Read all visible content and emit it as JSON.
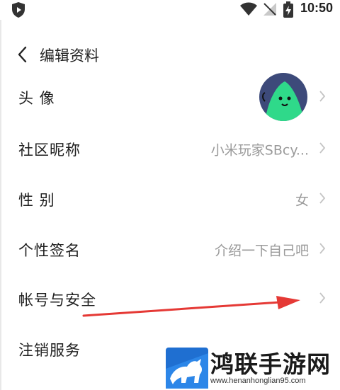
{
  "status_bar": {
    "time": "10:50",
    "icons": [
      "shield-icon",
      "wifi-icon",
      "no-signal-icon",
      "battery-charging-icon"
    ]
  },
  "header": {
    "title": "编辑资料",
    "back_icon": "chevron-left-icon"
  },
  "rows": [
    {
      "label": "头 像",
      "value": "",
      "kind": "avatar"
    },
    {
      "label": "社区昵称",
      "value": "小米玩家SBcy..."
    },
    {
      "label": "性 别",
      "value": "女"
    },
    {
      "label": "个性签名",
      "value": "介绍一下自己吧"
    },
    {
      "label": "帐号与安全",
      "value": ""
    },
    {
      "label": "注销服务",
      "value": ""
    }
  ],
  "annotation": {
    "color": "#e53935",
    "target": "帐号与安全"
  },
  "watermark": {
    "title": "鸿联手游网",
    "url": "www.henanhonglian95.com"
  },
  "colors": {
    "avatar_bg": "#3d4a7a",
    "avatar_fg": "#2fd98a",
    "chevron": "#c4c4c4",
    "value_text": "#9a9a9a"
  }
}
